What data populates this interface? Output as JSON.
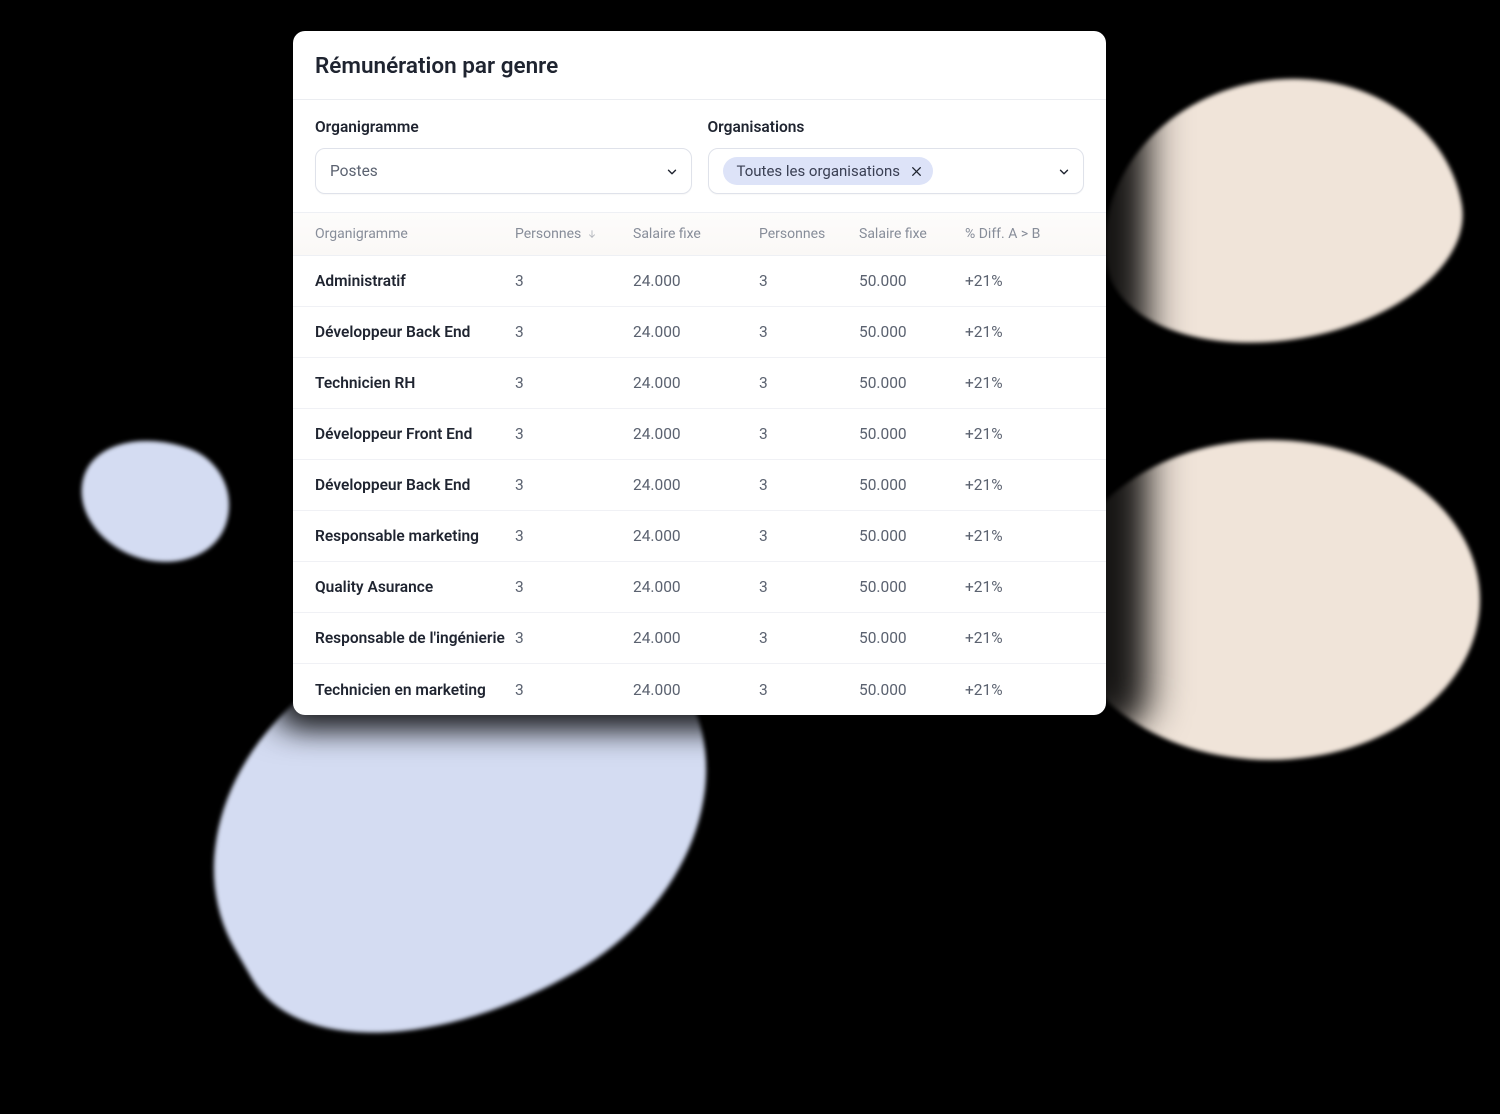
{
  "card": {
    "title": "Rémunération par genre",
    "filters": {
      "organigramme": {
        "label": "Organigramme",
        "value": "Postes"
      },
      "organisations": {
        "label": "Organisations",
        "tag": "Toutes les organisations"
      }
    }
  },
  "table": {
    "headers": {
      "organigramme": "Organigramme",
      "personnes_a": "Personnes",
      "salaire_a": "Salaire fixe",
      "personnes_b": "Personnes",
      "salaire_b": "Salaire fixe",
      "diff": "% Diff. A > B"
    },
    "rows": [
      {
        "name": "Administratif",
        "pA": "3",
        "sA": "24.000",
        "pB": "3",
        "sB": "50.000",
        "diff": "+21%"
      },
      {
        "name": "Développeur Back End",
        "pA": "3",
        "sA": "24.000",
        "pB": "3",
        "sB": "50.000",
        "diff": "+21%"
      },
      {
        "name": "Technicien RH",
        "pA": "3",
        "sA": "24.000",
        "pB": "3",
        "sB": "50.000",
        "diff": "+21%"
      },
      {
        "name": "Développeur Front End",
        "pA": "3",
        "sA": "24.000",
        "pB": "3",
        "sB": "50.000",
        "diff": "+21%"
      },
      {
        "name": "Développeur Back End",
        "pA": "3",
        "sA": "24.000",
        "pB": "3",
        "sB": "50.000",
        "diff": "+21%"
      },
      {
        "name": "Responsable marketing",
        "pA": "3",
        "sA": "24.000",
        "pB": "3",
        "sB": "50.000",
        "diff": "+21%"
      },
      {
        "name": "Quality Asurance",
        "pA": "3",
        "sA": "24.000",
        "pB": "3",
        "sB": "50.000",
        "diff": "+21%"
      },
      {
        "name": "Responsable de l'ingénierie",
        "pA": "3",
        "sA": "24.000",
        "pB": "3",
        "sB": "50.000",
        "diff": "+21%"
      },
      {
        "name": "Technicien en marketing",
        "pA": "3",
        "sA": "24.000",
        "pB": "3",
        "sB": "50.000",
        "diff": "+21%"
      }
    ]
  }
}
